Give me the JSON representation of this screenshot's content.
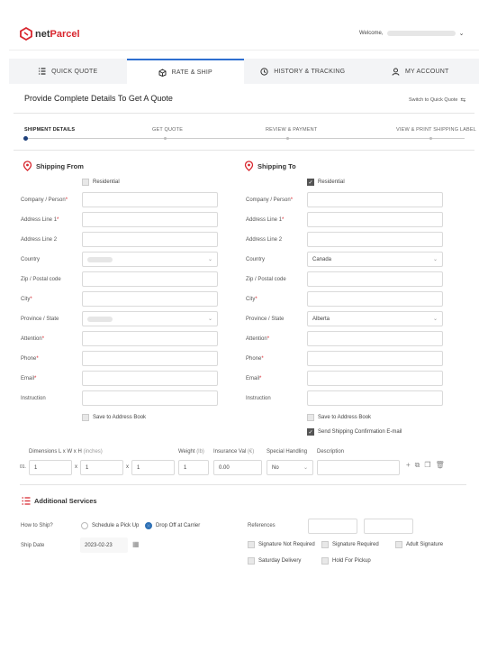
{
  "header": {
    "logo_prefix": "net",
    "logo_suffix": "Parcel",
    "welcome": "Welcome,"
  },
  "tabs": [
    {
      "label": "QUICK QUOTE",
      "icon": "list-icon"
    },
    {
      "label": "RATE & SHIP",
      "icon": "box-icon"
    },
    {
      "label": "HISTORY & TRACKING",
      "icon": "clock-icon"
    },
    {
      "label": "MY ACCOUNT",
      "icon": "user-icon"
    }
  ],
  "page": {
    "title": "Provide Complete Details To Get A Quote",
    "switch_label": "Switch to Quick Quote"
  },
  "steps": [
    "SHIPMENT DETAILS",
    "GET QUOTE",
    "REVIEW & PAYMENT",
    "VIEW & PRINT SHIPPING LABEL"
  ],
  "from": {
    "title": "Shipping From",
    "residential": "Residential",
    "fields": [
      "Company / Person",
      "Address Line 1",
      "Address Line 2",
      "Country",
      "Zip / Postal code",
      "City",
      "Province / State",
      "Attention",
      "Phone",
      "Email",
      "Instruction"
    ],
    "save": "Save to Address Book"
  },
  "to": {
    "title": "Shipping To",
    "residential": "Residential",
    "fields": [
      "Company / Person",
      "Address Line 1",
      "Address Line 2",
      "Country",
      "Zip / Postal code",
      "City",
      "Province / State",
      "Attention",
      "Phone",
      "Email",
      "Instruction"
    ],
    "country": "Canada",
    "province": "Alberta",
    "save": "Save to Address Book",
    "send_email": "Send Shipping Confirmation E-mail"
  },
  "package": {
    "dims_label": "Dimensions L x W x H",
    "dims_unit": "(inches)",
    "weight_label": "Weight",
    "weight_unit": "(lb)",
    "insurance_label": "Insurance Val",
    "insurance_unit": "(€)",
    "special_label": "Special Handling",
    "desc_label": "Description",
    "row_prefix": "01.",
    "l": "1",
    "w": "1",
    "h": "1",
    "x1": "x",
    "x2": "x",
    "weight": "1",
    "insurance": "0.00",
    "special": "No"
  },
  "additional": {
    "title": "Additional Services",
    "how_label": "How to Ship?",
    "opt_pickup": "Schedule a Pick Up",
    "opt_dropoff": "Drop Off at Carrier",
    "date_label": "Ship Date",
    "date": "2023-02-23",
    "ref_label": "References",
    "sig_not": "Signature Not Required",
    "sig_req": "Signature Required",
    "sig_adult": "Adult Signature",
    "saturday": "Saturday Delivery",
    "hold": "Hold For Pickup"
  }
}
